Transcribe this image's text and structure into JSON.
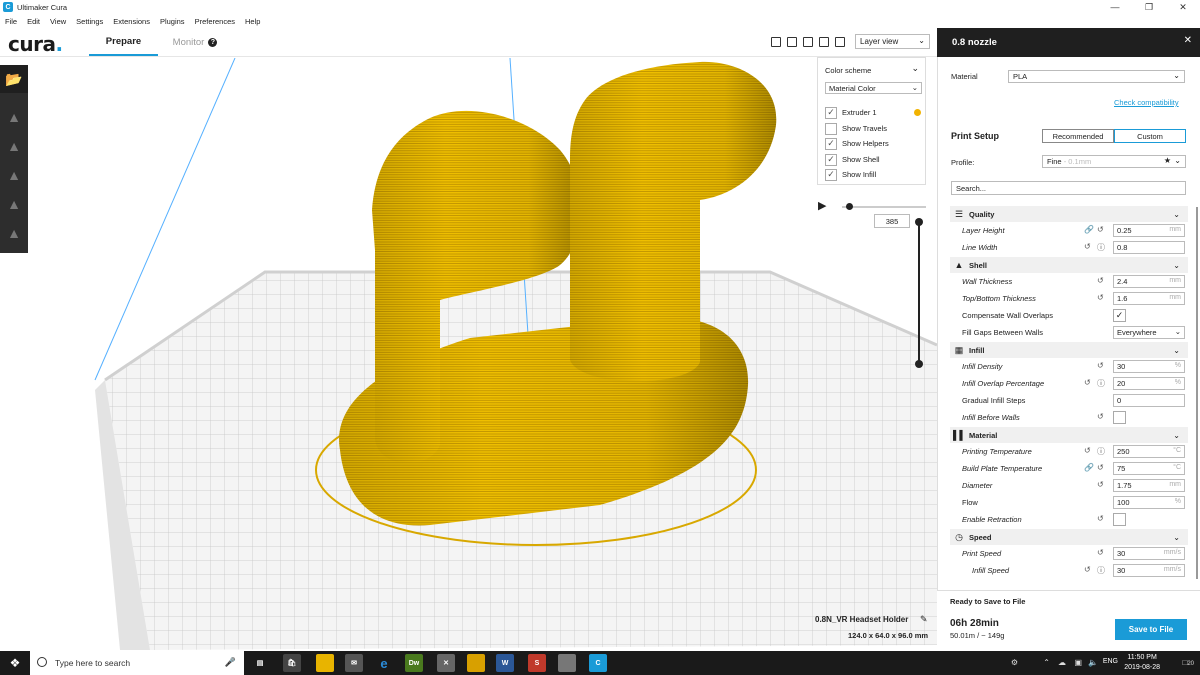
{
  "window": {
    "title": "Ultimaker Cura"
  },
  "menu": [
    "File",
    "Edit",
    "View",
    "Settings",
    "Extensions",
    "Plugins",
    "Preferences",
    "Help"
  ],
  "header": {
    "logo": "cura",
    "tabs": {
      "prepare": "Prepare",
      "monitor": "Monitor"
    },
    "view_mode": "Layer view"
  },
  "color_panel": {
    "title": "Color scheme",
    "scheme": "Material Color",
    "items": [
      {
        "label": "Extruder 1",
        "checked": true
      },
      {
        "label": "Show Travels",
        "checked": false
      },
      {
        "label": "Show Helpers",
        "checked": true
      },
      {
        "label": "Show Shell",
        "checked": true
      },
      {
        "label": "Show Infill",
        "checked": true
      }
    ],
    "extruder_color": "#f2b300"
  },
  "layer": {
    "current": "385"
  },
  "job": {
    "name": "0.8N_VR Headset Holder",
    "dims": "124.0 x 64.0 x 96.0 mm"
  },
  "sidebar": {
    "nozzle": "0.8 nozzle",
    "material_label": "Material",
    "material": "PLA",
    "check_compat": "Check compatibility",
    "print_setup": "Print Setup",
    "recommended": "Recommended",
    "custom": "Custom",
    "profile_label": "Profile:",
    "profile": "Fine",
    "profile_sub": "- 0.1mm",
    "search_placeholder": "Search..."
  },
  "settings": {
    "quality": {
      "label": "Quality",
      "layer_height": {
        "label": "Layer Height",
        "value": "0.25",
        "unit": "mm"
      },
      "line_width": {
        "label": "Line Width",
        "value": "0.8",
        "unit": ""
      }
    },
    "shell": {
      "label": "Shell",
      "wall_thickness": {
        "label": "Wall Thickness",
        "value": "2.4",
        "unit": "mm"
      },
      "topbottom": {
        "label": "Top/Bottom Thickness",
        "value": "1.6",
        "unit": "mm"
      },
      "comp_wall": {
        "label": "Compensate Wall Overlaps"
      },
      "fill_gaps": {
        "label": "Fill Gaps Between Walls",
        "value": "Everywhere"
      }
    },
    "infill": {
      "label": "Infill",
      "density": {
        "label": "Infill Density",
        "value": "30",
        "unit": "%"
      },
      "overlap": {
        "label": "Infill Overlap Percentage",
        "value": "20",
        "unit": "%"
      },
      "gradual": {
        "label": "Gradual Infill Steps",
        "value": "0"
      },
      "before_walls": {
        "label": "Infill Before Walls"
      }
    },
    "material": {
      "label": "Material",
      "print_temp": {
        "label": "Printing Temperature",
        "value": "250",
        "unit": "°C"
      },
      "bed_temp": {
        "label": "Build Plate Temperature",
        "value": "75",
        "unit": "°C"
      },
      "diameter": {
        "label": "Diameter",
        "value": "1.75",
        "unit": "mm"
      },
      "flow": {
        "label": "Flow",
        "value": "100",
        "unit": "%"
      },
      "retraction": {
        "label": "Enable Retraction"
      }
    },
    "speed": {
      "label": "Speed",
      "print_speed": {
        "label": "Print Speed",
        "value": "30",
        "unit": "mm/s"
      },
      "infill_speed": {
        "label": "Infill Speed",
        "value": "30",
        "unit": "mm/s"
      }
    }
  },
  "save": {
    "status": "Ready to Save to File",
    "time": "06h 28min",
    "usage": "50.01m / ~ 149g",
    "button": "Save to File"
  },
  "taskbar": {
    "search": "Type here to search",
    "lang": "ENG",
    "time": "11:50 PM",
    "date": "2019-08-28",
    "notif": "20"
  }
}
